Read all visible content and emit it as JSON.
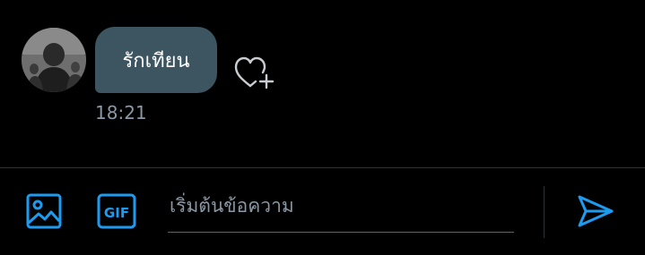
{
  "conversation": {
    "message": {
      "text": "รักเทียน",
      "timestamp": "18:21",
      "reaction_icon": "heart-plus-icon"
    },
    "sender_avatar": "avatar"
  },
  "composer": {
    "placeholder": "เริ่มต้นข้อความ",
    "value": "",
    "media_icon": "image-icon",
    "gif_icon": "gif-icon",
    "gif_label": "GIF",
    "send_icon": "send-icon"
  },
  "colors": {
    "background": "#000000",
    "bubble": "#3d5561",
    "accent": "#1d9bf0",
    "muted_text": "#8b98a5",
    "divider": "#2f3336"
  }
}
